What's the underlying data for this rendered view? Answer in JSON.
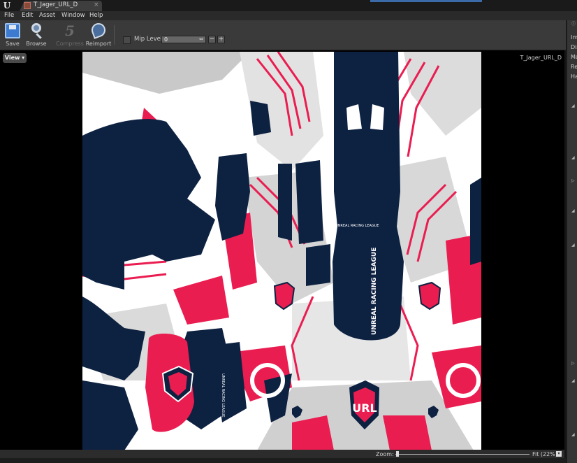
{
  "window": {
    "tab_title": "T_Jager_URL_D",
    "tab_close": "×"
  },
  "menu": [
    "File",
    "Edit",
    "Asset",
    "Window",
    "Help"
  ],
  "toolbar": {
    "save": "Save",
    "browse": "Browse",
    "compress": "Compress",
    "reimport": "Reimport",
    "mip_label": "Mip Level:",
    "mip_value": "0",
    "minus": "−",
    "plus": "+"
  },
  "viewport": {
    "view_button": "View ▾",
    "texture_name": "T_Jager_URL_D"
  },
  "texture": {
    "league_text": "UNREAL RACING LEAGUE",
    "logo_letters": "URL"
  },
  "zoom": {
    "label": "Zoom:",
    "value": "Fit (22%)",
    "fraction": 0.01
  },
  "details_panel": {
    "labels": [
      "Im",
      "Dis",
      "Ma",
      "Re",
      "Ha"
    ]
  },
  "colors": {
    "navy": "#0d2141",
    "red": "#ea1d51",
    "white": "#ffffff",
    "grey": "#c9c9c9"
  }
}
